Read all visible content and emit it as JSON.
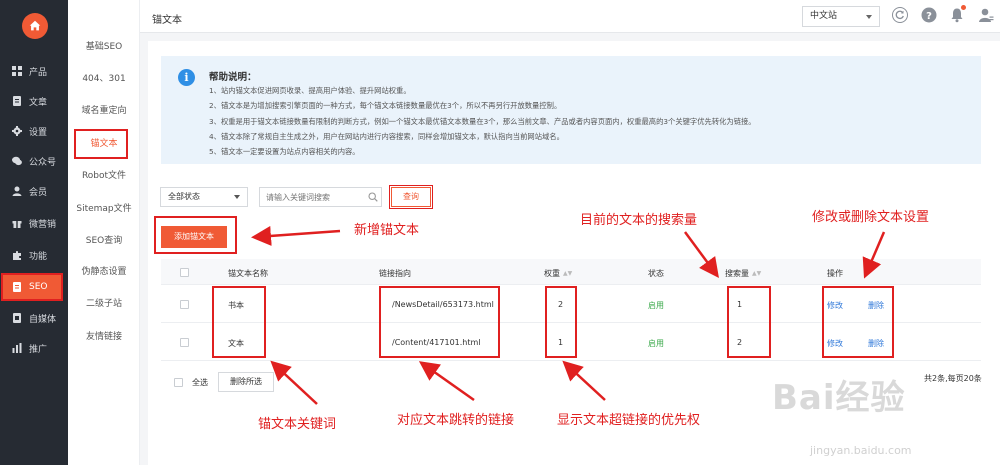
{
  "sidebar": {
    "items": [
      {
        "label": "产品",
        "icon": "grid-icon"
      },
      {
        "label": "文章",
        "icon": "document-icon"
      },
      {
        "label": "设置",
        "icon": "gear-icon"
      },
      {
        "label": "公众号",
        "icon": "wechat-icon"
      },
      {
        "label": "会员",
        "icon": "user-icon"
      },
      {
        "label": "微营销",
        "icon": "gift-icon"
      },
      {
        "label": "功能",
        "icon": "puzzle-icon"
      },
      {
        "label": "SEO",
        "icon": "seo-icon"
      },
      {
        "label": "自媒体",
        "icon": "media-icon"
      },
      {
        "label": "推广",
        "icon": "chart-icon"
      }
    ],
    "active": "SEO"
  },
  "subnav": {
    "items": [
      "基础SEO",
      "404、301",
      "域名重定向",
      "锚文本",
      "Robot文件",
      "Sitemap文件",
      "SEO查询",
      "伪静态设置",
      "二级子站",
      "友情链接"
    ],
    "active": "锚文本"
  },
  "header": {
    "title": "锚文本",
    "site_select": "中文站"
  },
  "help": {
    "title": "帮助说明：",
    "lines": [
      "1、站内锚文本促进网页收录、提高用户体验、提升网站权重。",
      "2、锚文本是为增加搜索引擎页面的一种方式，每个锚文本链接数量最优在3个，所以不再另行开放数量控制。",
      "3、权重是用于锚文本链接数量有限制的判断方式，例如一个锚文本最优锚文本数量在3个，那么当前文章、产品或者内容页面内，权重最高的3个关键字优先转化为链接。",
      "4、锚文本除了常规自主生成之外，用户在网站内进行内容搜索，同样会增加锚文本，默认指向当前网站域名。",
      "5、锚文本一定要设置为站点内容相关的内容。"
    ]
  },
  "filters": {
    "status": "全部状态",
    "search_placeholder": "请输入关键词搜索",
    "query_label": "查询"
  },
  "actions": {
    "add_label": "添加锚文本",
    "select_all_label": "全选",
    "delete_selected_label": "删除所选"
  },
  "table": {
    "headers": [
      "锚文本名称",
      "链接指向",
      "权重",
      "状态",
      "搜索量",
      "操作"
    ],
    "rows": [
      {
        "name": "书本",
        "link": "/NewsDetail/653173.html",
        "weight": "2",
        "status": "启用",
        "search_count": "1",
        "edit": "修改",
        "delete": "删除"
      },
      {
        "name": "文本",
        "link": "/Content/417101.html",
        "weight": "1",
        "status": "启用",
        "search_count": "2",
        "edit": "修改",
        "delete": "删除"
      }
    ]
  },
  "pager": {
    "text": "共2条,每页20条"
  },
  "annotations": {
    "add_note": "新增锚文本",
    "search_note": "目前的文本的搜索量",
    "ops_note": "修改或删除文本设置",
    "keyword_note": "锚文本关键词",
    "link_note": "对应文本跳转的链接",
    "weight_note": "显示文本超链接的优先权"
  },
  "watermark": {
    "main": "Bai经验",
    "sub": "jingyan.baidu.com"
  },
  "colors": {
    "accent": "#f05a35",
    "sidebar_bg": "#262b33",
    "annotation": "#e02020",
    "enabled": "#3aa84a",
    "link": "#2f78d9"
  }
}
